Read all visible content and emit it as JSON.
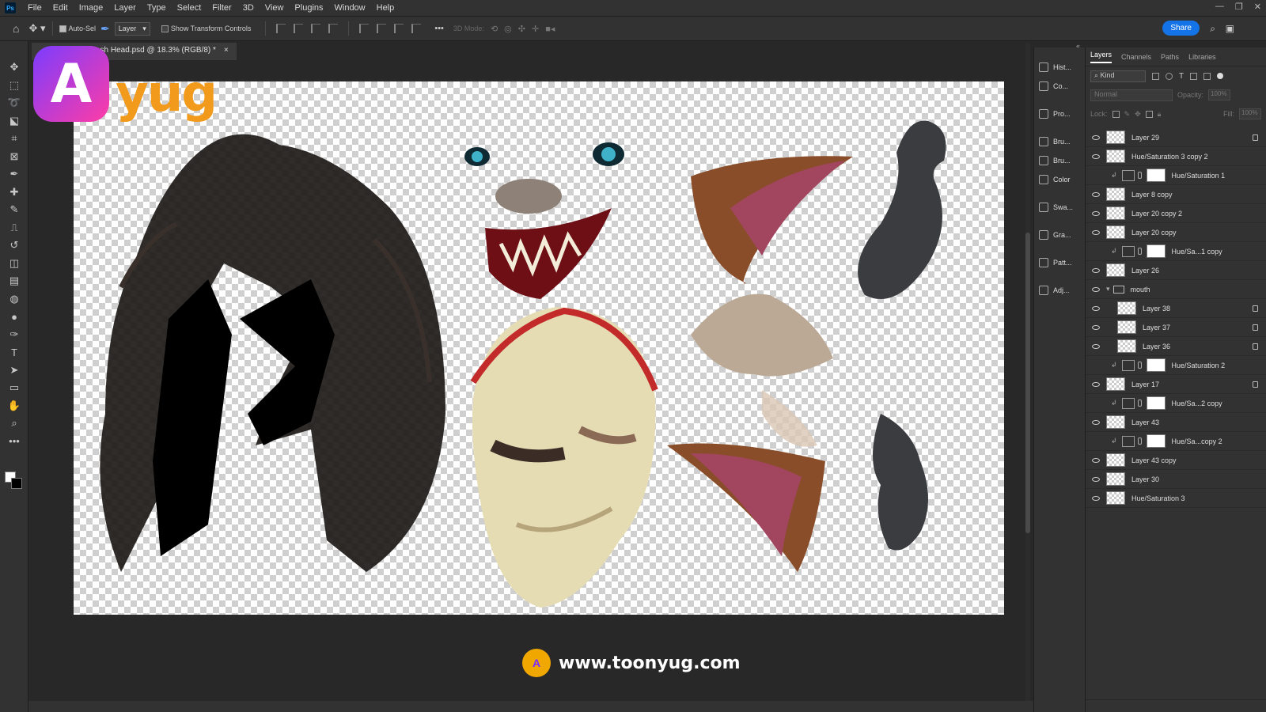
{
  "menubar": {
    "app_badge": "Ps",
    "items": [
      "File",
      "Edit",
      "Image",
      "Layer",
      "Type",
      "Select",
      "Filter",
      "3D",
      "View",
      "Plugins",
      "Window",
      "Help"
    ],
    "window_controls": [
      "minimize-icon",
      "restore-icon",
      "close-icon"
    ]
  },
  "options": {
    "auto_select_label": "Auto-Sel",
    "auto_select_target": "Layer",
    "show_transform_label": "Show Transform Controls",
    "mode_3d_label": "3D Mode:",
    "share_label": "Share",
    "more_glyph": "•••"
  },
  "document": {
    "tab_title": "sash Head.psd @ 18.3% (RGB/8) *",
    "close_glyph": "×"
  },
  "tools": [
    "move-tool-icon",
    "marquee-tool-icon",
    "lasso-tool-icon",
    "object-select-tool-icon",
    "crop-tool-icon",
    "frame-tool-icon",
    "eyedropper-tool-icon",
    "healing-brush-tool-icon",
    "brush-tool-icon",
    "clone-stamp-tool-icon",
    "history-brush-tool-icon",
    "eraser-tool-icon",
    "gradient-tool-icon",
    "blur-tool-icon",
    "dodge-tool-icon",
    "pen-tool-icon",
    "type-tool-icon",
    "path-select-tool-icon",
    "rectangle-tool-icon",
    "hand-tool-icon",
    "zoom-tool-icon",
    "more-tools-icon"
  ],
  "watermark": {
    "brand_mark": "A",
    "brand_text": "yug",
    "url": "www.toonyug.com"
  },
  "panel_strip": [
    {
      "label": "Hist...",
      "icon": "history-icon"
    },
    {
      "label": "Co...",
      "icon": "comments-icon"
    },
    {
      "label": "Pro...",
      "icon": "properties-icon"
    },
    {
      "label": "Bru...",
      "icon": "brush-settings-icon"
    },
    {
      "label": "Bru...",
      "icon": "brushes-icon"
    },
    {
      "label": "Color",
      "icon": "color-icon"
    },
    {
      "label": "Swa...",
      "icon": "swatches-icon"
    },
    {
      "label": "Gra...",
      "icon": "gradients-icon"
    },
    {
      "label": "Patt...",
      "icon": "patterns-icon"
    },
    {
      "label": "Adj...",
      "icon": "adjustments-icon"
    }
  ],
  "layers_panel": {
    "tabs": [
      "Layers",
      "Channels",
      "Paths",
      "Libraries"
    ],
    "active_tab": "Layers",
    "filter_kind": "Kind",
    "blend_mode": "Normal",
    "opacity_label": "Opacity:",
    "opacity_value": "100%",
    "lock_label": "Lock:",
    "fill_label": "Fill:",
    "fill_value": "100%",
    "layers": [
      {
        "name": "Layer 29",
        "type": "pixel",
        "visible": true,
        "locked": true
      },
      {
        "name": "Hue/Saturation 3 copy 2",
        "type": "pixel",
        "visible": true,
        "locked": false
      },
      {
        "name": "Hue/Saturation 1",
        "type": "adjustment",
        "visible": false,
        "locked": false
      },
      {
        "name": "Layer 8 copy",
        "type": "pixel",
        "visible": true,
        "locked": false
      },
      {
        "name": "Layer 20 copy 2",
        "type": "pixel",
        "visible": true,
        "locked": false
      },
      {
        "name": "Layer 20 copy",
        "type": "pixel",
        "visible": true,
        "locked": false
      },
      {
        "name": "Hue/Sa...1 copy",
        "type": "adjustment",
        "visible": false,
        "locked": false
      },
      {
        "name": "Layer 26",
        "type": "pixel",
        "visible": true,
        "locked": false
      },
      {
        "name": "mouth",
        "type": "group",
        "visible": true,
        "locked": false
      },
      {
        "name": "Layer 38",
        "type": "pixel-child",
        "visible": true,
        "locked": true
      },
      {
        "name": "Layer 37",
        "type": "pixel-child",
        "visible": true,
        "locked": true
      },
      {
        "name": "Layer 36",
        "type": "pixel-child",
        "visible": true,
        "locked": true
      },
      {
        "name": "Hue/Saturation 2",
        "type": "adjustment",
        "visible": false,
        "locked": false
      },
      {
        "name": "Layer 17",
        "type": "pixel",
        "visible": true,
        "locked": true
      },
      {
        "name": "Hue/Sa...2 copy",
        "type": "adjustment",
        "visible": false,
        "locked": false
      },
      {
        "name": "Layer 43",
        "type": "pixel",
        "visible": true,
        "locked": false
      },
      {
        "name": "Hue/Sa...copy 2",
        "type": "adjustment",
        "visible": false,
        "locked": false
      },
      {
        "name": "Layer 43 copy",
        "type": "pixel",
        "visible": true,
        "locked": false
      },
      {
        "name": "Layer 30",
        "type": "pixel",
        "visible": true,
        "locked": false
      },
      {
        "name": "Hue/Saturation 3",
        "type": "pixel",
        "visible": true,
        "locked": false
      }
    ]
  },
  "colors": {
    "ui_bg": "#323232",
    "canvas_area": "#282828",
    "accent_blue": "#1473e6",
    "brand_orange": "#f29a1c",
    "brand_purple": "#7b3cff"
  }
}
